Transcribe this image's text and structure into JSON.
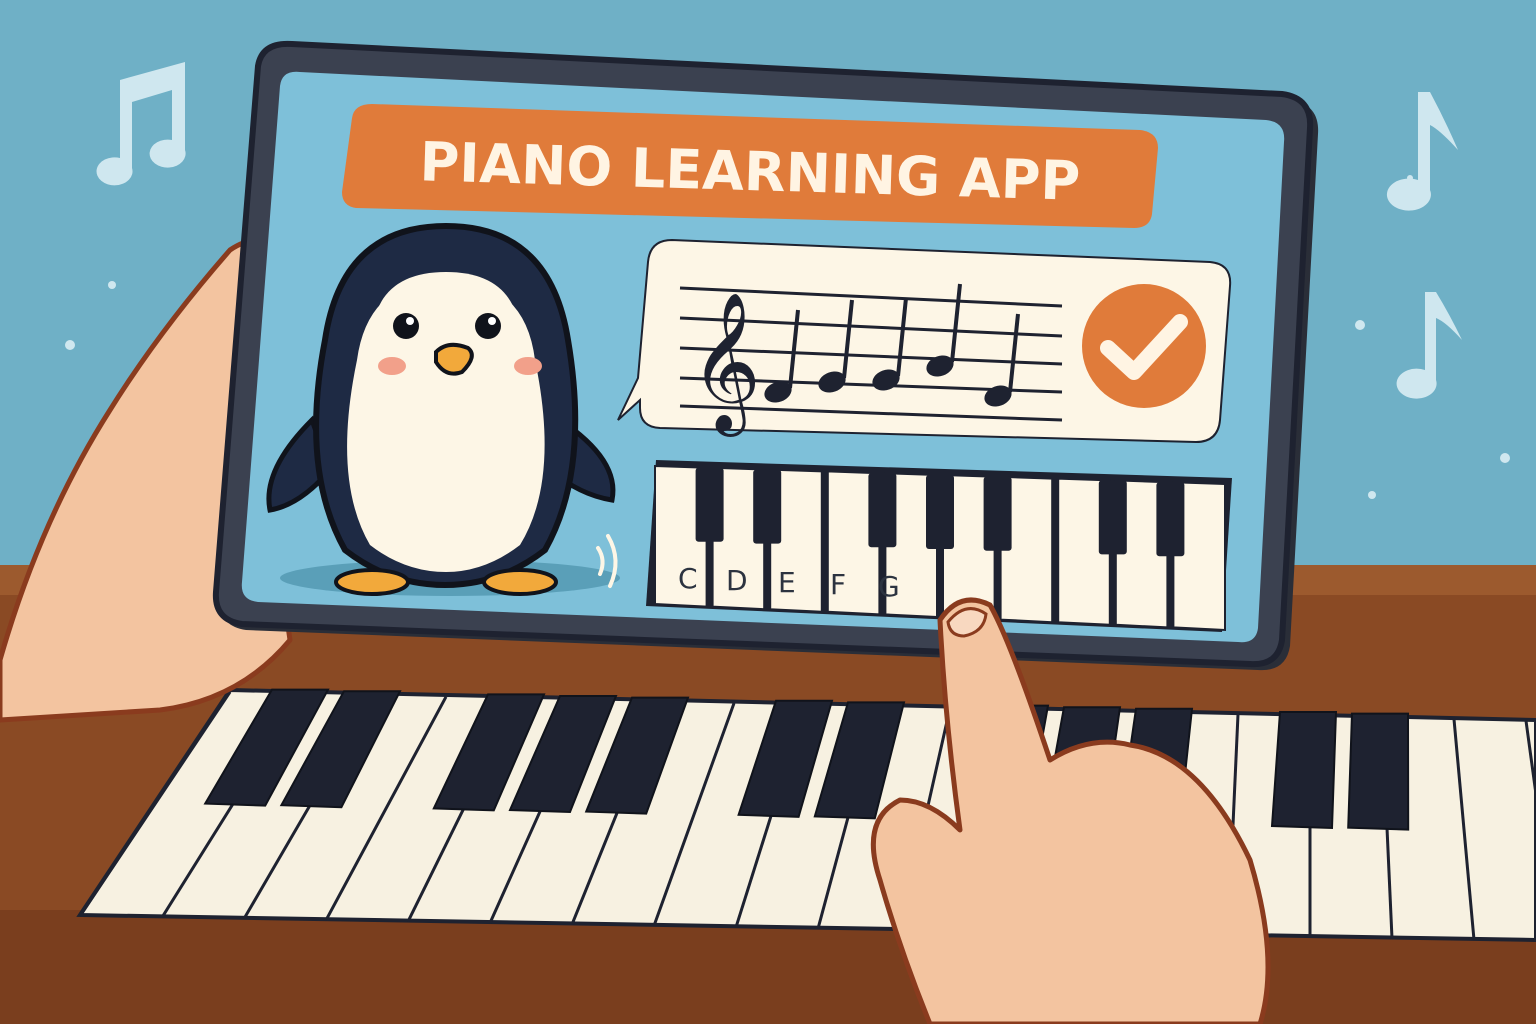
{
  "app": {
    "title": "PIANO LEARNING APP"
  },
  "lesson": {
    "status": "correct",
    "clef": "treble-clef",
    "notes_shown": 5
  },
  "keyboard": {
    "labels": [
      "C",
      "D",
      "E",
      "F",
      "G"
    ]
  },
  "icons": {
    "check": "checkmark-icon",
    "mascot": "penguin-mascot",
    "sound": "sound-waves-icon"
  },
  "colors": {
    "background": "#6fb0c6",
    "screen": "#7ec0d9",
    "accent": "#e07b3a",
    "title_text": "#fff4e3",
    "card": "#fdf6e6",
    "ink": "#1e2230",
    "wood": "#8a4a24",
    "skin": "#f3c4a0"
  }
}
